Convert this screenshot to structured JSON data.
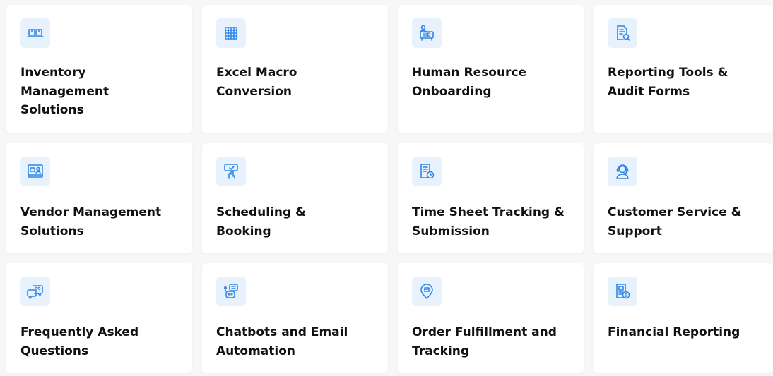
{
  "cards": [
    {
      "label": "Inventory\nManagement\nSolutions",
      "icon": "inventory-boxes-icon"
    },
    {
      "label": "Excel Macro\nConversion",
      "icon": "spreadsheet-icon"
    },
    {
      "label": "Human Resource\nOnboarding",
      "icon": "hr-icon"
    },
    {
      "label": "Reporting Tools &\nAudit Forms",
      "icon": "report-search-icon"
    },
    {
      "label": "Vendor Management\nSolutions",
      "icon": "vendor-monitor-icon"
    },
    {
      "label": "Scheduling &\nBooking",
      "icon": "scheduling-touch-icon"
    },
    {
      "label": "Time Sheet Tracking &\nSubmission",
      "icon": "timesheet-clock-icon"
    },
    {
      "label": "Customer Service &\nSupport",
      "icon": "support-headset-icon"
    },
    {
      "label": "Frequently Asked\nQuestions",
      "icon": "faq-chat-icon"
    },
    {
      "label": "Chatbots and Email\nAutomation",
      "icon": "chatbot-icon"
    },
    {
      "label": "Order Fulfillment and\nTracking",
      "icon": "order-location-icon"
    },
    {
      "label": "Financial Reporting",
      "icon": "financial-report-icon"
    }
  ],
  "colors": {
    "accent": "#2f86e8",
    "icon_bg": "#e8f2fd",
    "card_bg": "#ffffff",
    "page_bg": "#f7f7f8",
    "text": "#111111"
  }
}
